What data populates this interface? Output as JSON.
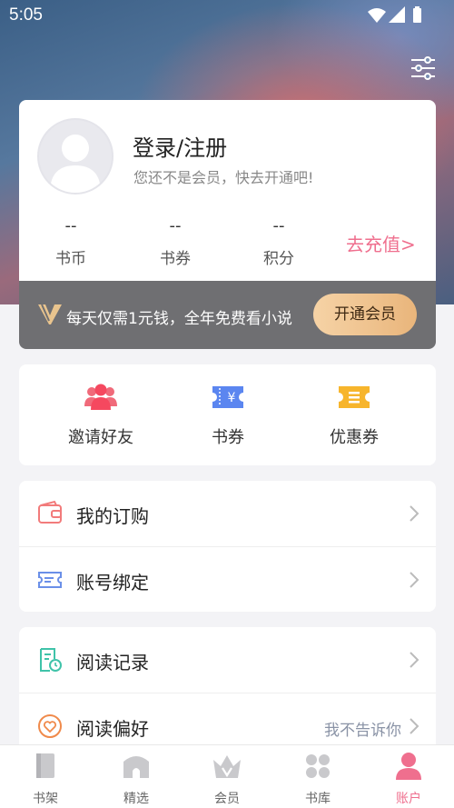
{
  "status_bar": {
    "time": "5:05"
  },
  "profile": {
    "login_title": "登录/注册",
    "subtitle": "您还不是会员，快去开通吧!",
    "stats": [
      {
        "value": "--",
        "label": "书币"
      },
      {
        "value": "--",
        "label": "书券"
      },
      {
        "value": "--",
        "label": "积分"
      }
    ],
    "recharge_link": "去充值>"
  },
  "vip_banner": {
    "text": "每天仅需1元钱，全年免费看小说",
    "button": "开通会员"
  },
  "quick_actions": [
    {
      "label": "邀请好友",
      "icon": "invite-friends-icon"
    },
    {
      "label": "书券",
      "icon": "ticket-icon"
    },
    {
      "label": "优惠券",
      "icon": "coupon-icon"
    }
  ],
  "menu_group_1": [
    {
      "label": "我的订购",
      "icon": "wallet-icon"
    },
    {
      "label": "账号绑定",
      "icon": "account-bind-icon"
    }
  ],
  "menu_group_2": [
    {
      "label": "阅读记录",
      "icon": "reading-history-icon"
    },
    {
      "label": "阅读偏好",
      "icon": "heart-icon",
      "value": "我不告诉你"
    }
  ],
  "tabs": [
    {
      "label": "书架",
      "icon": "bookshelf-icon"
    },
    {
      "label": "精选",
      "icon": "featured-icon"
    },
    {
      "label": "会员",
      "icon": "crown-icon"
    },
    {
      "label": "书库",
      "icon": "library-icon"
    },
    {
      "label": "账户",
      "icon": "account-icon",
      "active": true
    }
  ],
  "colors": {
    "accent": "#ef6f8e",
    "vip_gold": "#e9b57b",
    "vip_bar": "#6f6f72"
  }
}
